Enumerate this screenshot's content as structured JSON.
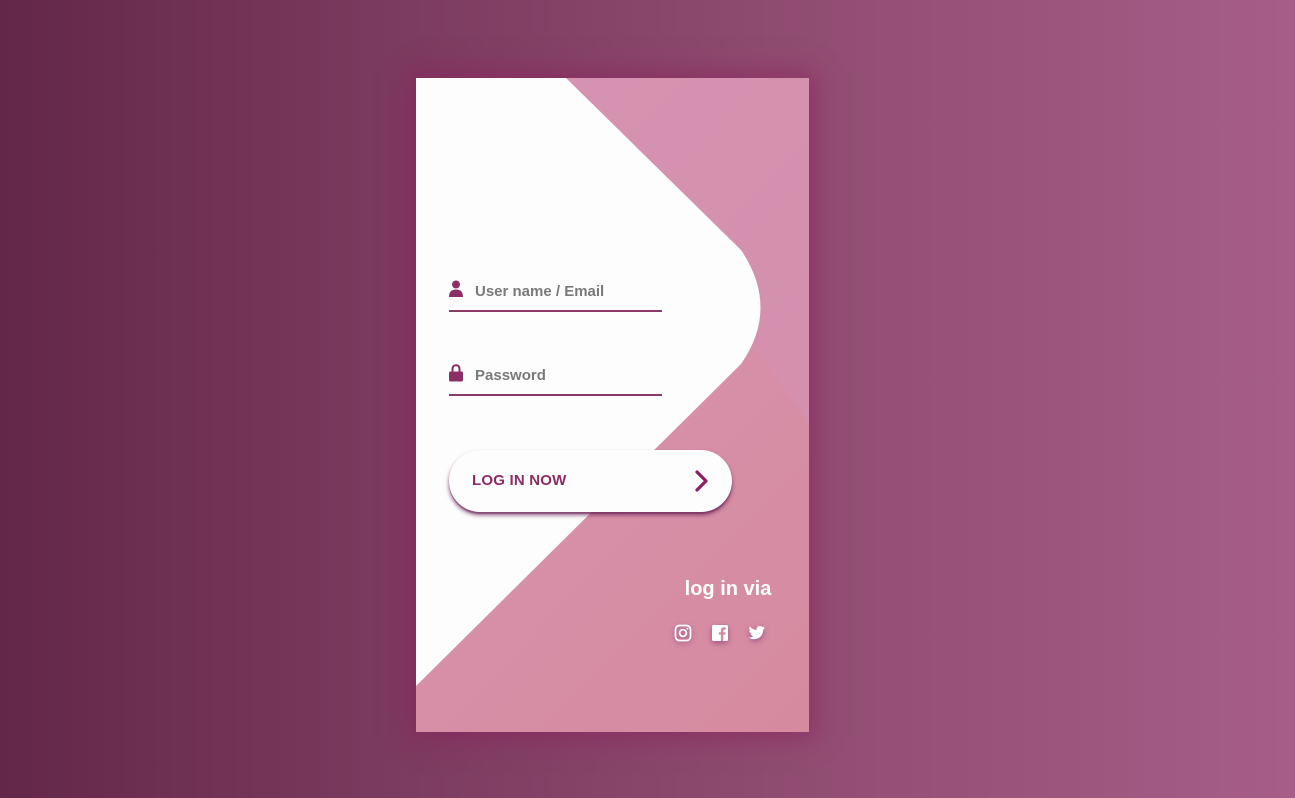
{
  "form": {
    "username_placeholder": "User name / Email",
    "username_value": "",
    "password_placeholder": "Password",
    "password_value": "",
    "login_button_label": "LOG IN NOW"
  },
  "social": {
    "heading": "log in via",
    "icons": [
      "instagram-icon",
      "facebook-icon",
      "twitter-icon"
    ]
  },
  "colors": {
    "accent": "#8a2d63",
    "card_pink": "#d68a9f",
    "background_dark": "#632749",
    "background_light": "#a65e88"
  }
}
